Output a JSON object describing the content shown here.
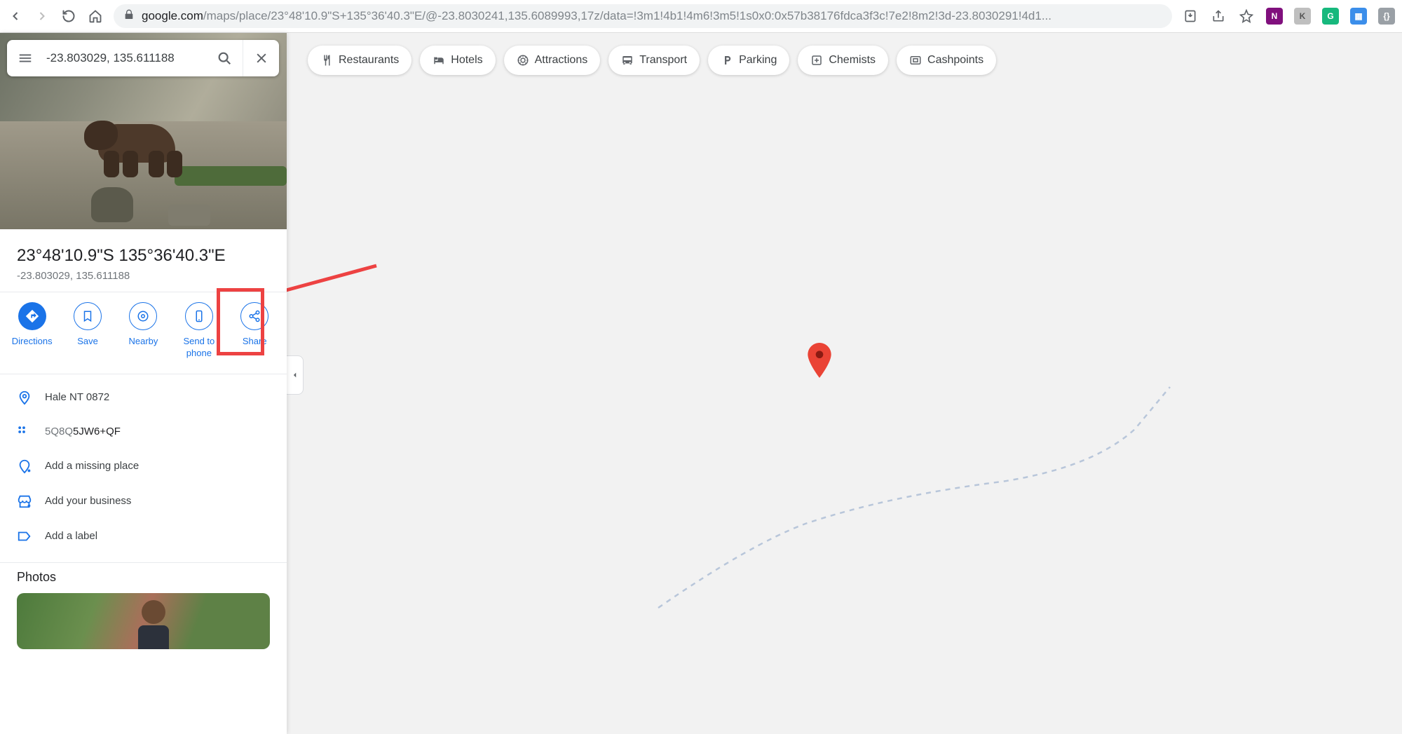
{
  "browser": {
    "url_host": "google.com",
    "url_path": "/maps/place/23°48'10.9\"S+135°36'40.3\"E/@-23.8030241,135.6089993,17z/data=!3m1!4b1!4m6!3m5!1s0x0:0x57b38176fdca3f3c!7e2!8m2!3d-23.8030291!4d1..."
  },
  "search": {
    "value": "-23.803029, 135.611188"
  },
  "place": {
    "title": "23°48'10.9\"S 135°36'40.3\"E",
    "subtitle": "-23.803029, 135.611188"
  },
  "actions": {
    "directions": "Directions",
    "save": "Save",
    "nearby": "Nearby",
    "send": "Send to phone",
    "share": "Share"
  },
  "info": {
    "address": "Hale NT 0872",
    "pluscode_prefix": "5Q8Q",
    "pluscode_suffix": "5JW6+QF",
    "missing": "Add a missing place",
    "business": "Add your business",
    "label": "Add a label"
  },
  "photos": {
    "heading": "Photos"
  },
  "chips": {
    "restaurants": "Restaurants",
    "hotels": "Hotels",
    "attractions": "Attractions",
    "transport": "Transport",
    "parking": "Parking",
    "chemists": "Chemists",
    "cashpoints": "Cashpoints"
  }
}
